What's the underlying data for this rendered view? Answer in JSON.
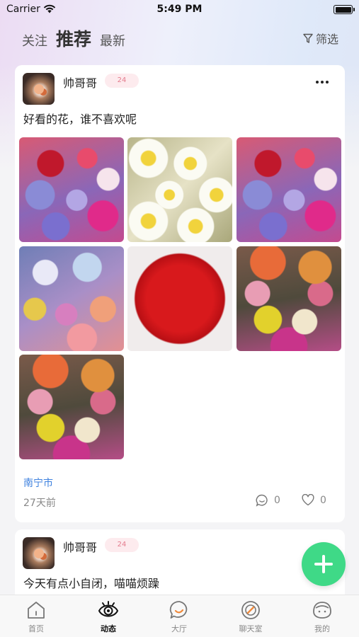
{
  "status_bar": {
    "carrier": "Carrier",
    "time": "5:49 PM"
  },
  "top_tabs": [
    {
      "label": "关注",
      "active": false
    },
    {
      "label": "推荐",
      "active": true
    },
    {
      "label": "最新",
      "active": false
    }
  ],
  "filter": {
    "label": "筛选",
    "icon": "filter-icon"
  },
  "posts": [
    {
      "username": "帅哥哥",
      "age_badge": "24",
      "text": "好看的花，谁不喜欢呢",
      "photos": [
        "pink-purple-flowers",
        "white-daisies",
        "pink-purple-flowers",
        "pastel-roses",
        "red-carnations",
        "mixed-flowers",
        "mixed-flowers"
      ],
      "location": "南宁市",
      "time_ago": "27天前",
      "comments": "0",
      "likes": "0"
    },
    {
      "username": "帅哥哥",
      "age_badge": "24",
      "text": "今天有点小自闭，喵喵烦躁"
    }
  ],
  "fab": {
    "icon": "plus-icon"
  },
  "bottom_nav": [
    {
      "label": "首页",
      "icon": "home-icon",
      "active": false
    },
    {
      "label": "动态",
      "icon": "eye-icon",
      "active": true
    },
    {
      "label": "大厅",
      "icon": "chat-bubble-icon",
      "active": false
    },
    {
      "label": "聊天室",
      "icon": "compass-icon",
      "active": false
    },
    {
      "label": "我的",
      "icon": "face-icon",
      "active": false
    }
  ],
  "colors": {
    "accent_green": "#3fd987",
    "location_blue": "#3f82df",
    "badge_pink": "#e47c8e"
  }
}
